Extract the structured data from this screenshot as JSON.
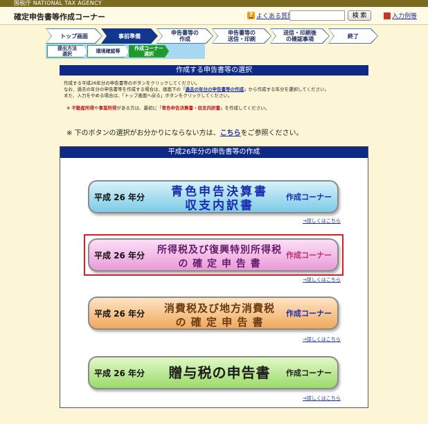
{
  "header": {
    "agency": "国税庁  NATIONAL TAX AGENCY",
    "app_title": "確定申告書等作成コーナー",
    "faq_label": "よくある質問",
    "search_value": "",
    "search_button": "検 索",
    "example_label": "入力例等"
  },
  "steps": [
    "トップ画面",
    "事前準備",
    "申告書等の\n作成",
    "申告書等の\n送信・印刷",
    "送信・印刷後\nの確認事項",
    "終了"
  ],
  "active_step_index": 1,
  "substeps": [
    "提出方法\n選択",
    "環境確認等",
    "作成コーナー\n選択"
  ],
  "active_substep_index": 2,
  "section_title": "作成する申告書等の選択",
  "instructions": {
    "line1": "作成する平成26年分の申告書等のボタンをクリックしてください。",
    "line2a": "なお、過去の年分の申告書等を作成する場合は、画面下の「",
    "line2link": "過去の年分の申告書等の作成",
    "line2b": "」から作成する年分を選択してください。",
    "line3": "また、入力をやめる場合は、「トップ画面へ戻る」ボタンをクリックしてください。"
  },
  "note": {
    "prefix": "※",
    "red1": "不動産所得",
    "mid1": "や",
    "red2": "事業所得",
    "mid2": "がある方は、最初に「",
    "red3": "青色申告決算書・収支内訳書",
    "suffix": "」を作成してください。"
  },
  "help": {
    "prefix": "※ 下のボタンの選択がお分かりにならない方は、",
    "link": "こちら",
    "suffix": "をご参照ください。"
  },
  "panel_title": "平成26年分の申告書等の作成",
  "options": [
    {
      "year": "平成 26 年分",
      "line1": "青色申告決算書",
      "line2": "収支内訳書",
      "corner": "作成コーナー",
      "details": "→詳しくはこちら"
    },
    {
      "year": "平成 26 年分",
      "line1": "所得税及び復興特別所得税",
      "line2": "の 確 定 申 告 書",
      "corner": "作成コーナー",
      "details": "→詳しくはこちら"
    },
    {
      "year": "平成 26 年分",
      "line1": "消費税及び地方消費税",
      "line2": "の 確 定 申 告 書",
      "corner": "作成コーナー",
      "details": "→詳しくはこちら"
    },
    {
      "year": "平成 26 年分",
      "line1": "贈与税の申告書",
      "line2": "",
      "corner": "作成コーナー",
      "details": "→詳しくはこちら"
    }
  ],
  "selected_option_index": 1
}
